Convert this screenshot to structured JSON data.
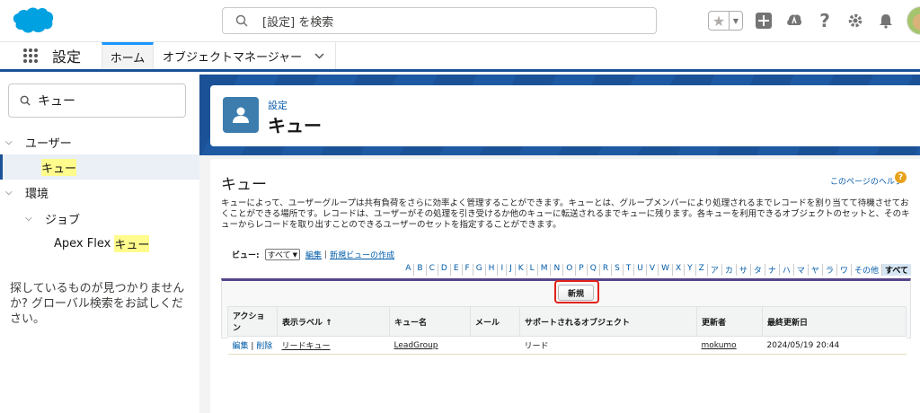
{
  "header": {
    "search_placeholder": "[設定] を検索"
  },
  "context_bar": {
    "app_name": "設定",
    "tabs": [
      {
        "label": "ホーム"
      },
      {
        "label": "オブジェクトマネージャー"
      }
    ]
  },
  "sidebar": {
    "search_value": "キュー",
    "tree": [
      {
        "label": "ユーザー"
      },
      {
        "label": "キュー"
      },
      {
        "label": "環境"
      },
      {
        "label": "ジョブ"
      },
      {
        "label_prefix": "Apex Flex ",
        "label_hl": "キュー"
      }
    ],
    "help_text": "探しているものが見つかりませんか? グローバル検索をお試しください。"
  },
  "page_header": {
    "breadcrumb": "設定",
    "title": "キュー"
  },
  "content": {
    "title": "キュー",
    "help_link": "このページのヘルプ",
    "description": "キューによって、ユーザーグループは共有負荷をさらに効率よく管理することができます。キューとは、グループメンバーにより処理されるまでレコードを割り当てて待機させておくことができる場所です。レコードは、ユーザーがその処理を引き受けるか他のキューに転送されるまでキューに残ります。各キューを利用できるオブジェクトのセットと、そのキューからレコードを取り出すことのできるユーザーのセットを指定することができます。",
    "view_label": "ビュー:",
    "view_select": "すべて",
    "edit_link": "編集",
    "new_view_link": "新規ビューの作成",
    "alphabet": [
      "A",
      "B",
      "C",
      "D",
      "E",
      "F",
      "G",
      "H",
      "I",
      "J",
      "K",
      "L",
      "M",
      "N",
      "O",
      "P",
      "Q",
      "R",
      "S",
      "T",
      "U",
      "V",
      "W",
      "X",
      "Y",
      "Z",
      "ア",
      "カ",
      "サ",
      "タ",
      "ナ",
      "ハ",
      "マ",
      "ヤ",
      "ラ",
      "ワ",
      "その他"
    ],
    "alphabet_all": "すべて",
    "new_button": "新規",
    "table": {
      "headers": [
        "アクション",
        "表示ラベル ↑",
        "キュー名",
        "メール",
        "サポートされるオブジェクト",
        "更新者",
        "最終更新日"
      ],
      "rows": [
        {
          "edit": "編集",
          "delete": "削除",
          "label": "リードキュー",
          "queue_name": "LeadGroup",
          "email": "",
          "objects": "リード",
          "updated_by": "mokumo",
          "updated_date": "2024/05/19 20:44"
        }
      ]
    }
  }
}
